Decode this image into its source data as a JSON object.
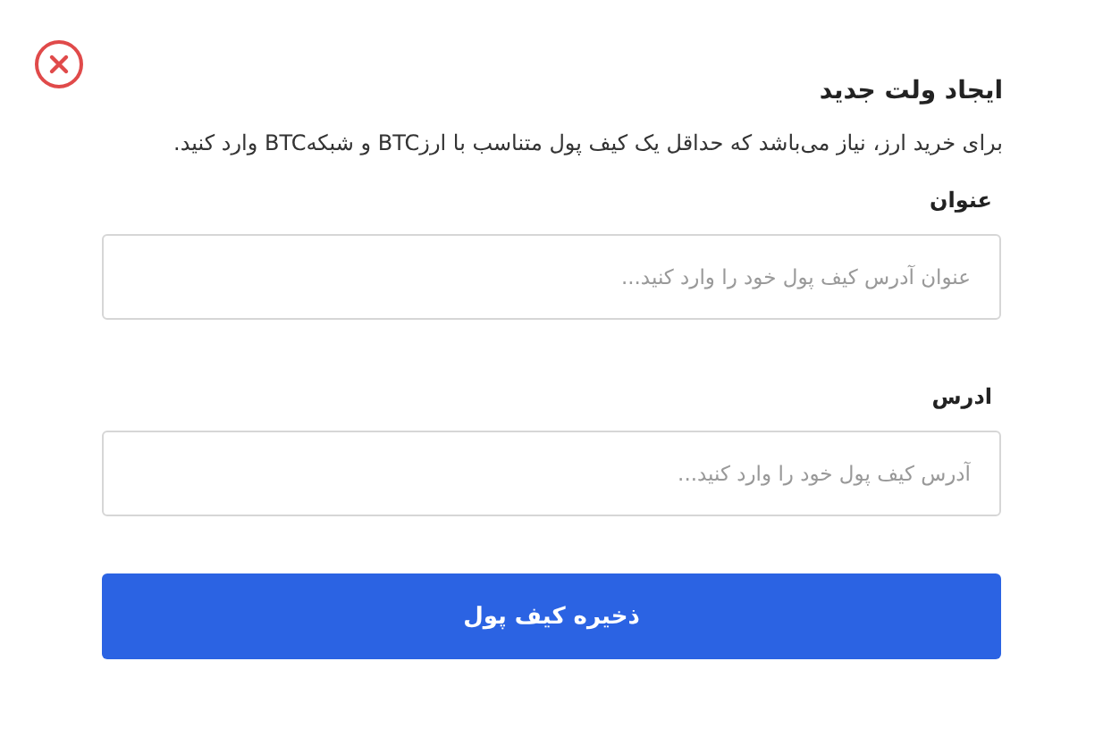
{
  "dialog": {
    "title": "ایجاد ولت جدید",
    "description": "برای خرید ارز، نیاز می‌باشد که حداقل یک کیف پول متناسب با ارزBTC و شبکهBTC وارد کنید.",
    "fields": [
      {
        "label": "عنوان",
        "placeholder": "عنوان آدرس کیف پول خود را وارد کنید..."
      },
      {
        "label": "ادرس",
        "placeholder": "آدرس کیف پول خود را وارد کنید..."
      }
    ],
    "submit": "ذخیره کیف پول"
  }
}
